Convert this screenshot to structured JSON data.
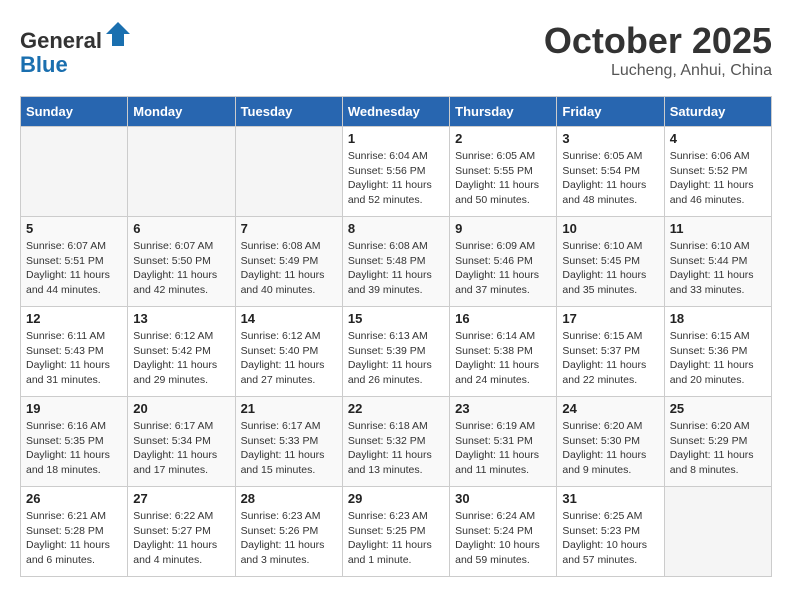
{
  "header": {
    "logo_line1": "General",
    "logo_line2": "Blue",
    "title": "October 2025",
    "subtitle": "Lucheng, Anhui, China"
  },
  "weekdays": [
    "Sunday",
    "Monday",
    "Tuesday",
    "Wednesday",
    "Thursday",
    "Friday",
    "Saturday"
  ],
  "weeks": [
    [
      {
        "day": "",
        "info": ""
      },
      {
        "day": "",
        "info": ""
      },
      {
        "day": "",
        "info": ""
      },
      {
        "day": "1",
        "info": "Sunrise: 6:04 AM\nSunset: 5:56 PM\nDaylight: 11 hours\nand 52 minutes."
      },
      {
        "day": "2",
        "info": "Sunrise: 6:05 AM\nSunset: 5:55 PM\nDaylight: 11 hours\nand 50 minutes."
      },
      {
        "day": "3",
        "info": "Sunrise: 6:05 AM\nSunset: 5:54 PM\nDaylight: 11 hours\nand 48 minutes."
      },
      {
        "day": "4",
        "info": "Sunrise: 6:06 AM\nSunset: 5:52 PM\nDaylight: 11 hours\nand 46 minutes."
      }
    ],
    [
      {
        "day": "5",
        "info": "Sunrise: 6:07 AM\nSunset: 5:51 PM\nDaylight: 11 hours\nand 44 minutes."
      },
      {
        "day": "6",
        "info": "Sunrise: 6:07 AM\nSunset: 5:50 PM\nDaylight: 11 hours\nand 42 minutes."
      },
      {
        "day": "7",
        "info": "Sunrise: 6:08 AM\nSunset: 5:49 PM\nDaylight: 11 hours\nand 40 minutes."
      },
      {
        "day": "8",
        "info": "Sunrise: 6:08 AM\nSunset: 5:48 PM\nDaylight: 11 hours\nand 39 minutes."
      },
      {
        "day": "9",
        "info": "Sunrise: 6:09 AM\nSunset: 5:46 PM\nDaylight: 11 hours\nand 37 minutes."
      },
      {
        "day": "10",
        "info": "Sunrise: 6:10 AM\nSunset: 5:45 PM\nDaylight: 11 hours\nand 35 minutes."
      },
      {
        "day": "11",
        "info": "Sunrise: 6:10 AM\nSunset: 5:44 PM\nDaylight: 11 hours\nand 33 minutes."
      }
    ],
    [
      {
        "day": "12",
        "info": "Sunrise: 6:11 AM\nSunset: 5:43 PM\nDaylight: 11 hours\nand 31 minutes."
      },
      {
        "day": "13",
        "info": "Sunrise: 6:12 AM\nSunset: 5:42 PM\nDaylight: 11 hours\nand 29 minutes."
      },
      {
        "day": "14",
        "info": "Sunrise: 6:12 AM\nSunset: 5:40 PM\nDaylight: 11 hours\nand 27 minutes."
      },
      {
        "day": "15",
        "info": "Sunrise: 6:13 AM\nSunset: 5:39 PM\nDaylight: 11 hours\nand 26 minutes."
      },
      {
        "day": "16",
        "info": "Sunrise: 6:14 AM\nSunset: 5:38 PM\nDaylight: 11 hours\nand 24 minutes."
      },
      {
        "day": "17",
        "info": "Sunrise: 6:15 AM\nSunset: 5:37 PM\nDaylight: 11 hours\nand 22 minutes."
      },
      {
        "day": "18",
        "info": "Sunrise: 6:15 AM\nSunset: 5:36 PM\nDaylight: 11 hours\nand 20 minutes."
      }
    ],
    [
      {
        "day": "19",
        "info": "Sunrise: 6:16 AM\nSunset: 5:35 PM\nDaylight: 11 hours\nand 18 minutes."
      },
      {
        "day": "20",
        "info": "Sunrise: 6:17 AM\nSunset: 5:34 PM\nDaylight: 11 hours\nand 17 minutes."
      },
      {
        "day": "21",
        "info": "Sunrise: 6:17 AM\nSunset: 5:33 PM\nDaylight: 11 hours\nand 15 minutes."
      },
      {
        "day": "22",
        "info": "Sunrise: 6:18 AM\nSunset: 5:32 PM\nDaylight: 11 hours\nand 13 minutes."
      },
      {
        "day": "23",
        "info": "Sunrise: 6:19 AM\nSunset: 5:31 PM\nDaylight: 11 hours\nand 11 minutes."
      },
      {
        "day": "24",
        "info": "Sunrise: 6:20 AM\nSunset: 5:30 PM\nDaylight: 11 hours\nand 9 minutes."
      },
      {
        "day": "25",
        "info": "Sunrise: 6:20 AM\nSunset: 5:29 PM\nDaylight: 11 hours\nand 8 minutes."
      }
    ],
    [
      {
        "day": "26",
        "info": "Sunrise: 6:21 AM\nSunset: 5:28 PM\nDaylight: 11 hours\nand 6 minutes."
      },
      {
        "day": "27",
        "info": "Sunrise: 6:22 AM\nSunset: 5:27 PM\nDaylight: 11 hours\nand 4 minutes."
      },
      {
        "day": "28",
        "info": "Sunrise: 6:23 AM\nSunset: 5:26 PM\nDaylight: 11 hours\nand 3 minutes."
      },
      {
        "day": "29",
        "info": "Sunrise: 6:23 AM\nSunset: 5:25 PM\nDaylight: 11 hours\nand 1 minute."
      },
      {
        "day": "30",
        "info": "Sunrise: 6:24 AM\nSunset: 5:24 PM\nDaylight: 10 hours\nand 59 minutes."
      },
      {
        "day": "31",
        "info": "Sunrise: 6:25 AM\nSunset: 5:23 PM\nDaylight: 10 hours\nand 57 minutes."
      },
      {
        "day": "",
        "info": ""
      }
    ]
  ]
}
